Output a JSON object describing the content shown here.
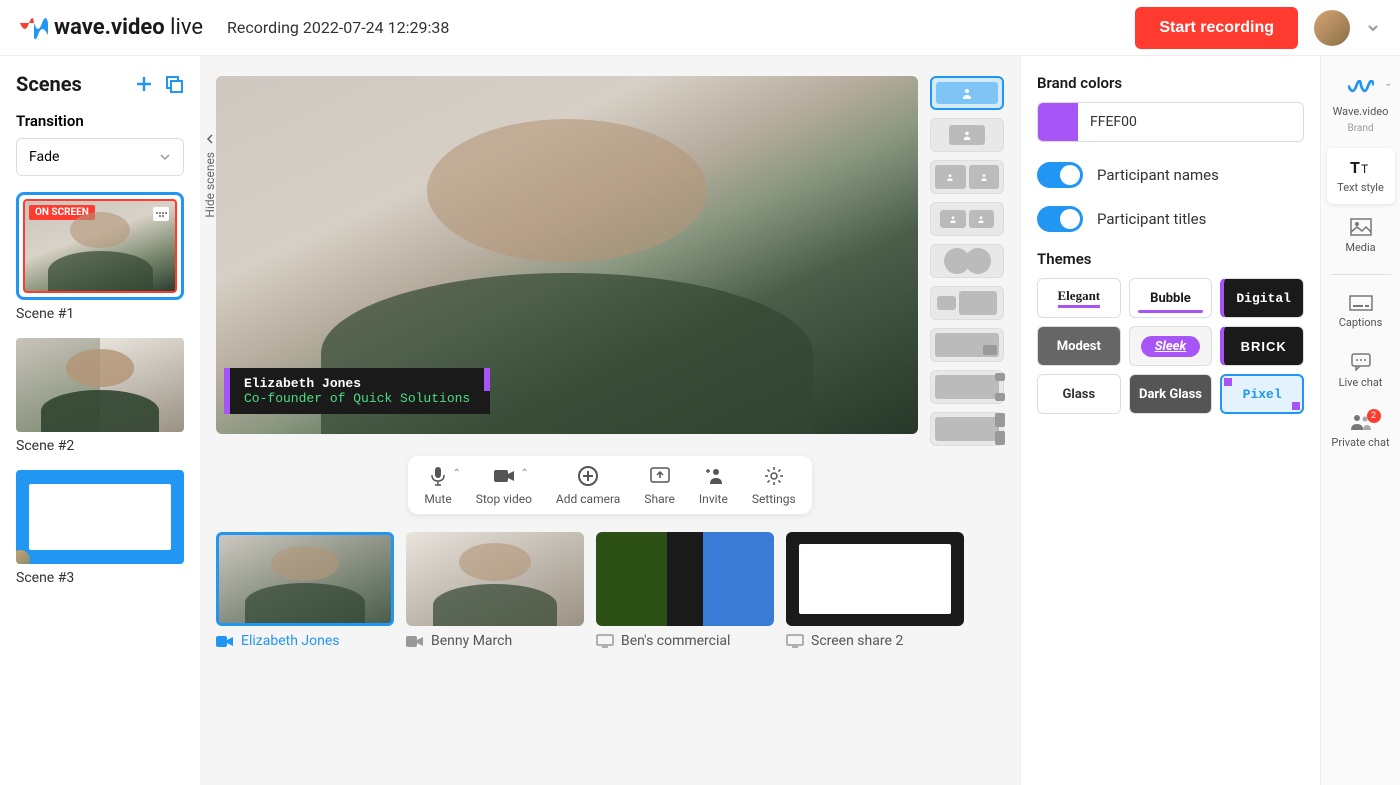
{
  "header": {
    "logo_text": "wave.video",
    "logo_suffix": "live",
    "title": "Recording 2022-07-24 12:29:38",
    "start_button": "Start recording"
  },
  "scenes": {
    "title": "Scenes",
    "transition_label": "Transition",
    "transition_value": "Fade",
    "hide_label": "Hide scenes",
    "items": [
      {
        "label": "Scene #1",
        "badge": "ON SCREEN",
        "active": true
      },
      {
        "label": "Scene #2"
      },
      {
        "label": "Scene #3"
      }
    ]
  },
  "lower_third": {
    "name": "Elizabeth Jones",
    "title": "Co-founder of Quick Solutions"
  },
  "controls": {
    "mute": "Mute",
    "stop_video": "Stop video",
    "add_camera": "Add camera",
    "share": "Share",
    "invite": "Invite",
    "settings": "Settings"
  },
  "participants": [
    {
      "name": "Elizabeth Jones",
      "type": "camera",
      "active": true
    },
    {
      "name": "Benny March",
      "type": "camera"
    },
    {
      "name": "Ben's commercial",
      "type": "screen"
    },
    {
      "name": "Screen share 2",
      "type": "screen"
    }
  ],
  "config": {
    "brand_colors_title": "Brand colors",
    "color_value": "FFEF00",
    "color_swatch": "#a855f7",
    "toggle_names": "Participant names",
    "toggle_titles": "Participant titles",
    "themes_title": "Themes",
    "themes": [
      "Elegant",
      "Bubble",
      "Digital",
      "Modest",
      "Sleek",
      "BRICK",
      "Glass",
      "Dark Glass",
      "Pixel"
    ]
  },
  "rail": {
    "brand": {
      "label": "Wave.video",
      "sub": "Brand"
    },
    "text_style": "Text style",
    "media": "Media",
    "captions": "Captions",
    "live_chat": "Live chat",
    "private_chat": "Private chat",
    "private_chat_badge": "2"
  }
}
